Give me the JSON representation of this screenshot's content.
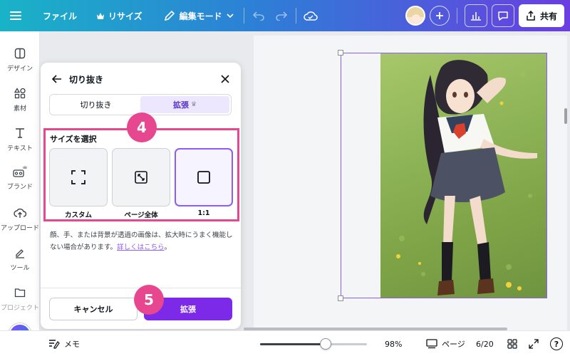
{
  "topbar": {
    "file_label": "ファイル",
    "resize_label": "リサイズ",
    "edit_mode_label": "編集モード",
    "share_label": "共有"
  },
  "sidebar": {
    "items": [
      {
        "label": "デザイン",
        "icon": "layout-icon"
      },
      {
        "label": "素材",
        "icon": "shapes-icon"
      },
      {
        "label": "テキスト",
        "icon": "text-icon"
      },
      {
        "label": "ブランド",
        "icon": "brand-icon"
      },
      {
        "label": "アップロード",
        "icon": "upload-icon"
      },
      {
        "label": "ツール",
        "icon": "pen-icon"
      },
      {
        "label": "プロジェクト",
        "icon": "folder-icon"
      }
    ]
  },
  "panel": {
    "title": "切り抜き",
    "tabs": [
      {
        "label": "切り抜き",
        "active": false
      },
      {
        "label": "拡張",
        "active": true
      }
    ],
    "size_section_title": "サイズを選択",
    "options": [
      {
        "label": "カスタム",
        "selected": false
      },
      {
        "label": "ページ全体",
        "selected": false
      },
      {
        "label": "1:1",
        "selected": true
      }
    ],
    "description": "顔、手、または背景が透過の画像は、拡大時にうまく機能しない場合があります。",
    "learn_more_link": "詳しくはこちら",
    "desc_suffix": "。",
    "cancel_label": "キャンセル",
    "expand_label": "拡張"
  },
  "steps": {
    "step4": "4",
    "step5": "5"
  },
  "bottombar": {
    "notes_label": "メモ",
    "zoom_percent": "98%",
    "zoom_level": 0.61,
    "pages_label": "ページ",
    "page_counter": "6/20",
    "help_label": "?"
  },
  "colors": {
    "accent": "#7d2ae8",
    "highlight": "#e6478f",
    "selected_border": "#8b5cf6"
  }
}
